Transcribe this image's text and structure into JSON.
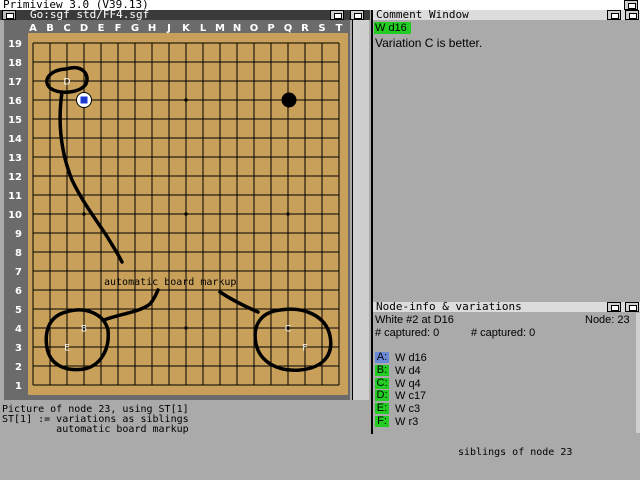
{
  "screen": {
    "title": "Primiview 3.0 (V39.13)"
  },
  "board_window": {
    "title": "Go:sgf_std/FF4.sgf",
    "columns": [
      "A",
      "B",
      "C",
      "D",
      "E",
      "F",
      "G",
      "H",
      "J",
      "K",
      "L",
      "M",
      "N",
      "O",
      "P",
      "Q",
      "R",
      "S",
      "T"
    ],
    "rows": [
      "19",
      "18",
      "17",
      "16",
      "15",
      "14",
      "13",
      "12",
      "11",
      "10",
      "9",
      "8",
      "7",
      "6",
      "5",
      "4",
      "3",
      "2",
      "1"
    ],
    "variation_labels": [
      "D",
      "B",
      "E",
      "C",
      "F"
    ],
    "annotation": "automatic board markup",
    "board_color": "#c8a05a"
  },
  "comment_window": {
    "title": "Comment Window",
    "move_badge": "W d16",
    "comment": "Variation C is better.",
    "badge_color": "#22cc22"
  },
  "node_window": {
    "title": "Node-info & variations",
    "move_info": "White #2 at D16",
    "node": "Node: 23",
    "captured_black": "# captured: 0",
    "captured_white": "# captured: 0",
    "variations": [
      {
        "letter": "A:",
        "move": "W d16",
        "color": "#6a8ad8"
      },
      {
        "letter": "B:",
        "move": "W d4",
        "color": "#22cc22"
      },
      {
        "letter": "C:",
        "move": "W q4",
        "color": "#22cc22"
      },
      {
        "letter": "D:",
        "move": "W c17",
        "color": "#22cc22"
      },
      {
        "letter": "E:",
        "move": "W c3",
        "color": "#22cc22"
      },
      {
        "letter": "F:",
        "move": "W r3",
        "color": "#22cc22"
      }
    ]
  },
  "caption": {
    "line1": "Picture of node 23, using ST[1]",
    "line2": "ST[1] := variations as siblings",
    "line3": "         automatic board markup",
    "siblings": "siblings of node 23"
  }
}
